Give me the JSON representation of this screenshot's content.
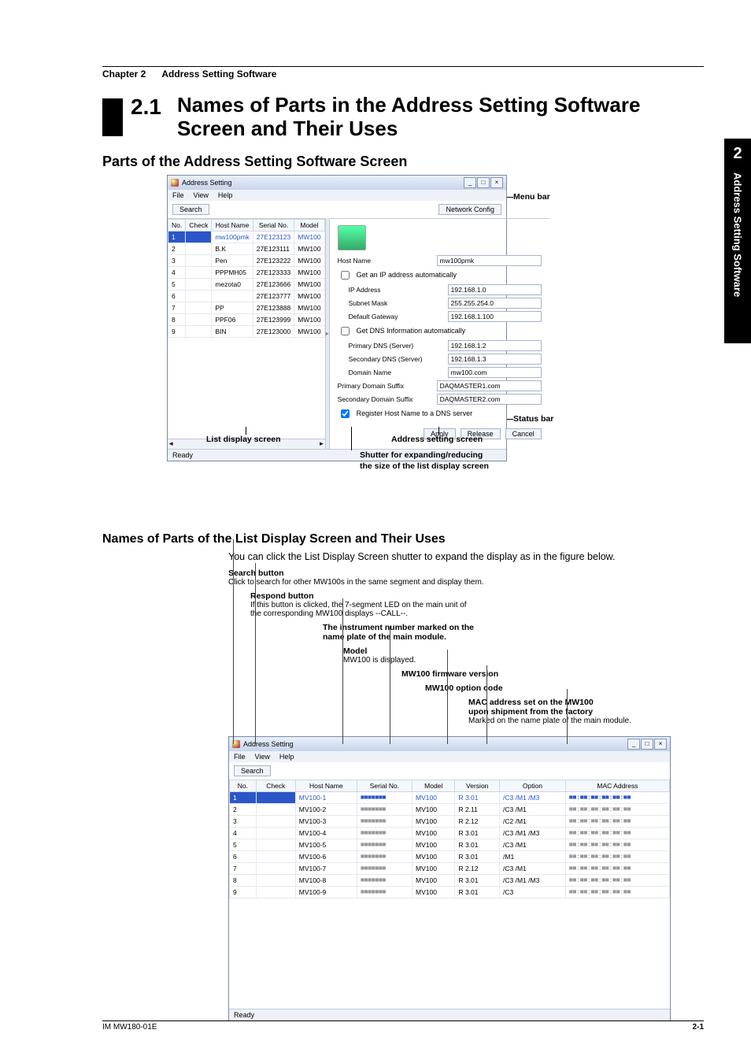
{
  "sideTab": {
    "num": "2",
    "title": "Address Setting Software"
  },
  "header": {
    "chapter": "Chapter 2",
    "title": "Address Setting Software"
  },
  "section": {
    "num": "2.1",
    "title": "Names of Parts in the Address Setting Software Screen and Their Uses"
  },
  "h2_1": "Parts of the Address Setting Software Screen",
  "h3_1": "Names of Parts of the List Display Screen and Their Uses",
  "body_1": "You can click the List Display Screen shutter to expand the display as in the figure below.",
  "figure1": {
    "appTitle": "Address Setting",
    "menus": [
      "File",
      "View",
      "Help"
    ],
    "searchBtn": "Search",
    "netConfBtn": "Network Config",
    "columns": [
      "No.",
      "Check",
      "Host Name",
      "Serial No.",
      "Model"
    ],
    "rows": [
      {
        "no": "1",
        "host": "mw100pmk",
        "serial": "27E123123",
        "model": "MW100",
        "sel": true
      },
      {
        "no": "2",
        "host": "B.K",
        "serial": "27E123111",
        "model": "MW100"
      },
      {
        "no": "3",
        "host": "Pen",
        "serial": "27E123222",
        "model": "MW100"
      },
      {
        "no": "4",
        "host": "PPPMH05",
        "serial": "27E123333",
        "model": "MW100"
      },
      {
        "no": "5",
        "host": "mezota0",
        "serial": "27E123666",
        "model": "MW100"
      },
      {
        "no": "6",
        "host": "",
        "serial": "27E123777",
        "model": "MW100"
      },
      {
        "no": "7",
        "host": "PP",
        "serial": "27E123888",
        "model": "MW100"
      },
      {
        "no": "8",
        "host": "PPF06",
        "serial": "27E123999",
        "model": "MW100"
      },
      {
        "no": "9",
        "host": "BIN",
        "serial": "27E123000",
        "model": "MW100"
      }
    ],
    "form": {
      "hostNameLabel": "Host Name",
      "hostName": "mw100pmk",
      "autoIpLabel": "Get an IP address automatically",
      "ipLabel": "IP Address",
      "ip": "192.168.1.0",
      "maskLabel": "Subnet Mask",
      "mask": "255.255.254.0",
      "gwLabel": "Default Gateway",
      "gw": "192.168.1.100",
      "autoDnsLabel": "Get DNS Information automatically",
      "pdnsLabel": "Primary DNS (Server)",
      "pdns": "192.168.1.2",
      "sdnsLabel": "Secondary DNS (Server)",
      "sdns": "192.168.1.3",
      "domainLabel": "Domain Name",
      "domain": "mw100.com",
      "pdsLabel": "Primary Domain Suffix",
      "pds": "DAQMASTER1.com",
      "sdsLabel": "Secondary Domain Suffix",
      "sds": "DAQMASTER2.com",
      "regLabel": "Register Host Name to a DNS server",
      "applyBtn": "Apply",
      "releaseBtn": "Release",
      "cancelBtn": "Cancel"
    },
    "status": "Ready",
    "annots": {
      "menubar": "Menu bar",
      "statusbar": "Status bar",
      "listScreen": "List display screen",
      "addrScreen": "Address setting screen",
      "shutter1": "Shutter for expanding/reducing",
      "shutter2": "the size of the list display screen"
    }
  },
  "legend": {
    "search": {
      "title": "Search button",
      "desc": "Click to search for other MW100s in the same segment and display them."
    },
    "respond": {
      "title": "Respond button",
      "desc1": "If this button is clicked, the 7-segment LED on the main unit of",
      "desc2": "the corresponding MW100 displays --CALL--."
    },
    "instrNo": {
      "l1": "The instrument number marked on the",
      "l2": "name plate of the main module."
    },
    "model": {
      "title": "Model",
      "desc": "MW100 is displayed."
    },
    "fw": "MW100 firmware version",
    "option": "MW100 option code",
    "mac": {
      "l1": "MAC address set on the MW100",
      "l2": "upon shipment from the factory",
      "l3": "Marked on the name plate of the main module."
    }
  },
  "figure2": {
    "appTitle": "Address Setting",
    "menus": [
      "File",
      "View",
      "Help"
    ],
    "searchBtn": "Search",
    "columns": [
      "No.",
      "Check",
      "Host Name",
      "Serial No.",
      "Model",
      "Version",
      "Option",
      "MAC Address"
    ],
    "rows": [
      {
        "no": "1",
        "host": "MV100-1",
        "serial": "■■■■■■■",
        "model": "MV100",
        "ver": "R 3.01",
        "opt": "/C3  /M1  /M3",
        "sel": true
      },
      {
        "no": "2",
        "host": "MV100-2",
        "serial": "■■■■■■■",
        "model": "MV100",
        "ver": "R 2.11",
        "opt": "/C3  /M1"
      },
      {
        "no": "3",
        "host": "MV100-3",
        "serial": "■■■■■■■",
        "model": "MV100",
        "ver": "R 2.12",
        "opt": "/C2  /M1"
      },
      {
        "no": "4",
        "host": "MV100-4",
        "serial": "■■■■■■■",
        "model": "MV100",
        "ver": "R 3.01",
        "opt": "/C3  /M1  /M3"
      },
      {
        "no": "5",
        "host": "MV100-5",
        "serial": "■■■■■■■",
        "model": "MV100",
        "ver": "R 3.01",
        "opt": "/C3  /M1"
      },
      {
        "no": "6",
        "host": "MV100-6",
        "serial": "■■■■■■■",
        "model": "MV100",
        "ver": "R 3.01",
        "opt": "/M1"
      },
      {
        "no": "7",
        "host": "MV100-7",
        "serial": "■■■■■■■",
        "model": "MV100",
        "ver": "R 2.12",
        "opt": "/C3  /M1"
      },
      {
        "no": "8",
        "host": "MV100-8",
        "serial": "■■■■■■■",
        "model": "MV100",
        "ver": "R 3.01",
        "opt": "/C3  /M1  /M3"
      },
      {
        "no": "9",
        "host": "MV100-9",
        "serial": "■■■■■■■",
        "model": "MV100",
        "ver": "R 3.01",
        "opt": "/C3"
      }
    ],
    "status": "Ready"
  },
  "footer": {
    "left": "IM MW180-01E",
    "right": "2-1"
  }
}
